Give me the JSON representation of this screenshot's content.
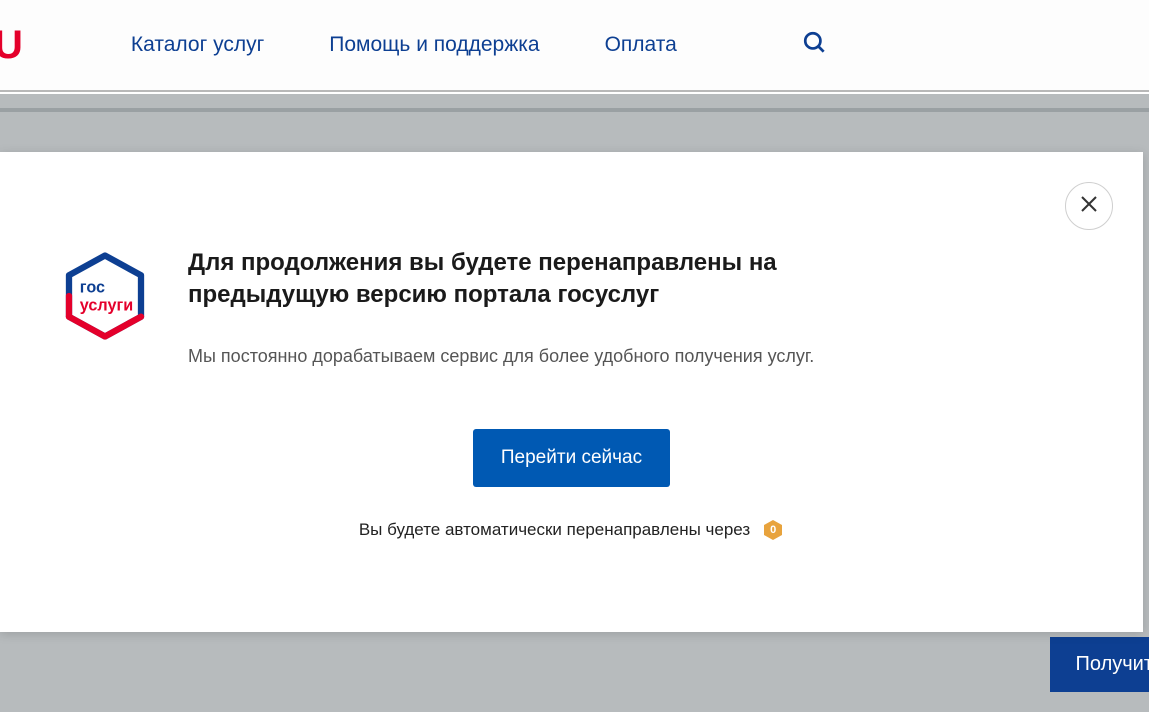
{
  "nav": {
    "logo_fragment": "U",
    "items": [
      "Каталог услуг",
      "Помощь и поддержка",
      "Оплата"
    ]
  },
  "modal": {
    "title": "Для продолжения вы будете перенаправлены на предыдущую версию портала госуслуг",
    "subtitle": "Мы постоянно дорабатываем сервис для более удобного получения услуг.",
    "button": "Перейти сейчас",
    "redirect_text": "Вы будете автоматически перенаправлены через",
    "countdown": "0",
    "logo_text_top": "гос",
    "logo_text_bottom": "услуги"
  },
  "footer": {
    "get_button": "Получит"
  }
}
